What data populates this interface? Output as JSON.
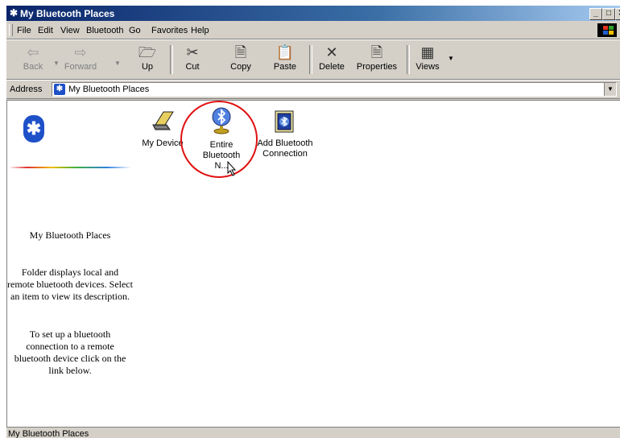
{
  "window": {
    "title": "My Bluetooth Places"
  },
  "menu": [
    "File",
    "Edit",
    "View",
    "Bluetooth",
    "Go",
    "Favorites",
    "Help"
  ],
  "toolbar": {
    "back": "Back",
    "forward": "Forward",
    "up": "Up",
    "cut": "Cut",
    "copy": "Copy",
    "paste": "Paste",
    "delete": "Delete",
    "properties": "Properties",
    "views": "Views"
  },
  "address": {
    "label": "Address",
    "value": "My Bluetooth Places"
  },
  "left_panel": {
    "title": "My Bluetooth Places",
    "description": "Folder displays local and remote bluetooth devices. Select an item to view its description.",
    "setup_text": "To set up a bluetooth connection to a remote bluetooth device click on the link below."
  },
  "items": [
    {
      "label": "My Device",
      "icon": "laptop-icon"
    },
    {
      "label": "Entire Bluetooth N...",
      "icon": "bluetooth-globe-icon"
    },
    {
      "label": "Add Bluetooth Connection",
      "icon": "add-connection-icon"
    }
  ],
  "status": {
    "text": "My Bluetooth Places"
  },
  "colors": {
    "title_start": "#0a246a",
    "title_end": "#a6caf0",
    "bluetooth": "#1e50c8",
    "highlight": "#e01010"
  }
}
